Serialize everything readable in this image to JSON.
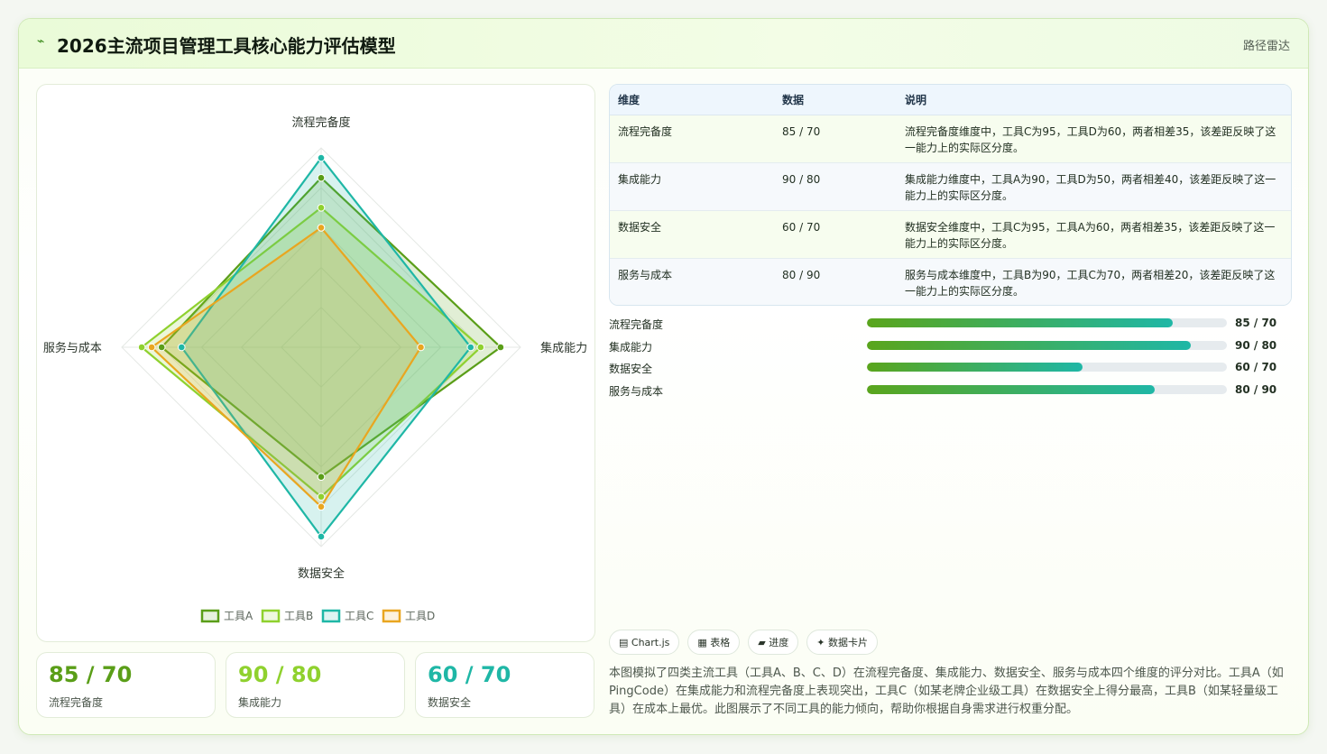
{
  "header": {
    "logo": "⌁",
    "title": "2026主流项目管理工具核心能力评估模型",
    "tag": "路径雷达"
  },
  "chart_data": {
    "type": "radar",
    "axes": [
      "流程完备度",
      "集成能力",
      "数据安全",
      "服务与成本"
    ],
    "range": [
      0,
      100
    ],
    "series": [
      {
        "name": "工具A",
        "values": [
          85,
          90,
          65,
          80
        ],
        "color": "#5a9e18"
      },
      {
        "name": "工具B",
        "values": [
          70,
          80,
          75,
          90
        ],
        "color": "#8fd12e"
      },
      {
        "name": "工具C",
        "values": [
          95,
          75,
          95,
          70
        ],
        "color": "#1fb7a6"
      },
      {
        "name": "工具D",
        "values": [
          60,
          50,
          80,
          85
        ],
        "color": "#e9a620"
      }
    ]
  },
  "kpis": [
    {
      "value": "85 / 70",
      "label": "流程完备度",
      "color": "#5a9e18"
    },
    {
      "value": "90 / 80",
      "label": "集成能力",
      "color": "#8fd12e"
    },
    {
      "value": "60 / 70",
      "label": "数据安全",
      "color": "#1fb7a6"
    }
  ],
  "table": {
    "headers": [
      "维度",
      "数据",
      "说明"
    ],
    "rows": [
      {
        "dim": "流程完备度",
        "num": "85 / 70",
        "desc": "流程完备度维度中，工具C为95，工具D为60，两者相差35，该差距反映了这一能力上的实际区分度。"
      },
      {
        "dim": "集成能力",
        "num": "90 / 80",
        "desc": "集成能力维度中，工具A为90，工具D为50，两者相差40，该差距反映了这一能力上的实际区分度。"
      },
      {
        "dim": "数据安全",
        "num": "60 / 70",
        "desc": "数据安全维度中，工具C为95，工具A为60，两者相差35，该差距反映了这一能力上的实际区分度。"
      },
      {
        "dim": "服务与成本",
        "num": "80 / 90",
        "desc": "服务与成本维度中，工具B为90，工具C为70，两者相差20，该差距反映了这一能力上的实际区分度。"
      }
    ]
  },
  "progress": [
    {
      "name": "流程完备度",
      "value": "85 / 70",
      "percent": 85
    },
    {
      "name": "集成能力",
      "value": "90 / 80",
      "percent": 90
    },
    {
      "name": "数据安全",
      "value": "60 / 70",
      "percent": 60
    },
    {
      "name": "服务与成本",
      "value": "80 / 90",
      "percent": 80
    }
  ],
  "pills": [
    "▤ Chart.js",
    "▦ 表格",
    "▰ 进度",
    "✦ 数据卡片"
  ],
  "description": "本图模拟了四类主流工具（工具A、B、C、D）在流程完备度、集成能力、数据安全、服务与成本四个维度的评分对比。工具A（如PingCode）在集成能力和流程完备度上表现突出，工具C（如某老牌企业级工具）在数据安全上得分最高，工具B（如某轻量级工具）在成本上最优。此图展示了不同工具的能力倾向，帮助你根据自身需求进行权重分配。"
}
